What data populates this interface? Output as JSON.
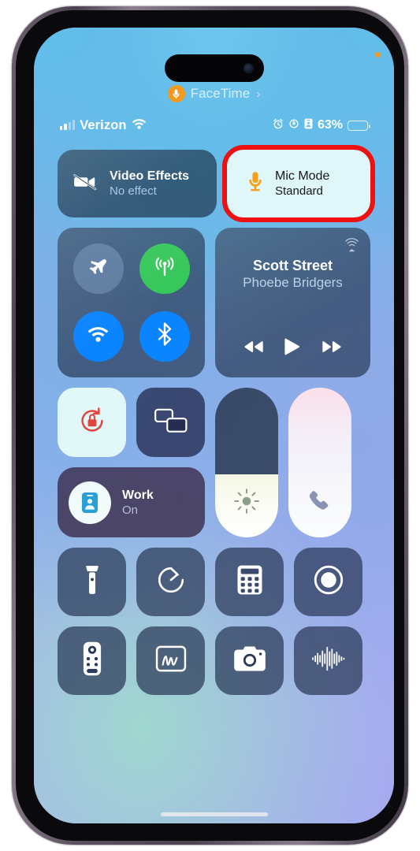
{
  "device": {
    "name": "iphone-14-pro",
    "screen_label": "Control Center"
  },
  "status_bar": {
    "carrier": "Verizon",
    "signal_bars_total": 4,
    "signal_bars_filled": 2,
    "wifi_icon": "wifi-icon",
    "alarm_icon": "alarm-clock-icon",
    "rotation_lock_icon": "rotation-lock-icon",
    "focus_icon": "focus-id-card-icon",
    "battery_percent": "63%",
    "battery_level": 63,
    "battery_icon": "battery-icon"
  },
  "facetime_banner": {
    "label": "FaceTime",
    "mic_icon": "microphone-icon",
    "chevron": "›",
    "badge_color": "#f29a1f",
    "recording_dot_color": "#f09a22"
  },
  "controls": {
    "video_effects": {
      "icon": "video-camera-slash-icon",
      "title": "Video Effects",
      "subtitle": "No effect"
    },
    "mic_mode": {
      "icon": "microphone-icon",
      "title": "Mic Mode",
      "subtitle": "Standard",
      "highlighted": true,
      "highlight_color": "#ee1111",
      "tile_background": "#dff7f8",
      "icon_color": "#f2a01e"
    },
    "connectivity": {
      "airplane_mode": {
        "icon": "airplane-icon",
        "state": "off",
        "color": "#80a0c8"
      },
      "cellular_data": {
        "icon": "cellular-antenna-icon",
        "state": "on",
        "color": "#35c759"
      },
      "wifi": {
        "icon": "wifi-icon",
        "state": "on",
        "color": "#0a84ff"
      },
      "bluetooth": {
        "icon": "bluetooth-icon",
        "state": "on",
        "color": "#0a84ff"
      }
    },
    "now_playing": {
      "title": "Scott Street",
      "artist": "Phoebe Bridgers",
      "airplay_icon": "airplay-audio-icon",
      "rewind_icon": "rewind-icon",
      "play_icon": "play-icon",
      "forward_icon": "fast-forward-icon",
      "playback_state": "paused"
    },
    "rotation_lock": {
      "icon": "rotation-lock-icon",
      "state": "on",
      "icon_color": "#e33b3b"
    },
    "screen_mirroring": {
      "icon": "screen-mirroring-icon",
      "state": "off"
    },
    "focus": {
      "icon": "id-card-icon",
      "name": "Work",
      "state": "On",
      "icon_color": "#2a9fd6"
    },
    "brightness": {
      "icon": "sun-icon",
      "value": 42,
      "label": "Brightness"
    },
    "volume": {
      "icon": "phone-handset-icon",
      "value": 100,
      "label": "Volume"
    },
    "shortcuts_row_1": [
      {
        "icon": "flashlight-icon",
        "name": "flashlight"
      },
      {
        "icon": "timer-icon",
        "name": "timer"
      },
      {
        "icon": "calculator-icon",
        "name": "calculator"
      },
      {
        "icon": "screen-record-icon",
        "name": "screen-recording"
      }
    ],
    "shortcuts_row_2": [
      {
        "icon": "apple-tv-remote-icon",
        "name": "apple-tv-remote"
      },
      {
        "icon": "quick-note-icon",
        "name": "quick-note"
      },
      {
        "icon": "camera-icon",
        "name": "camera"
      },
      {
        "icon": "sound-recognition-icon",
        "name": "sound-recognition"
      }
    ]
  },
  "home_indicator": {
    "label": "home-indicator"
  }
}
